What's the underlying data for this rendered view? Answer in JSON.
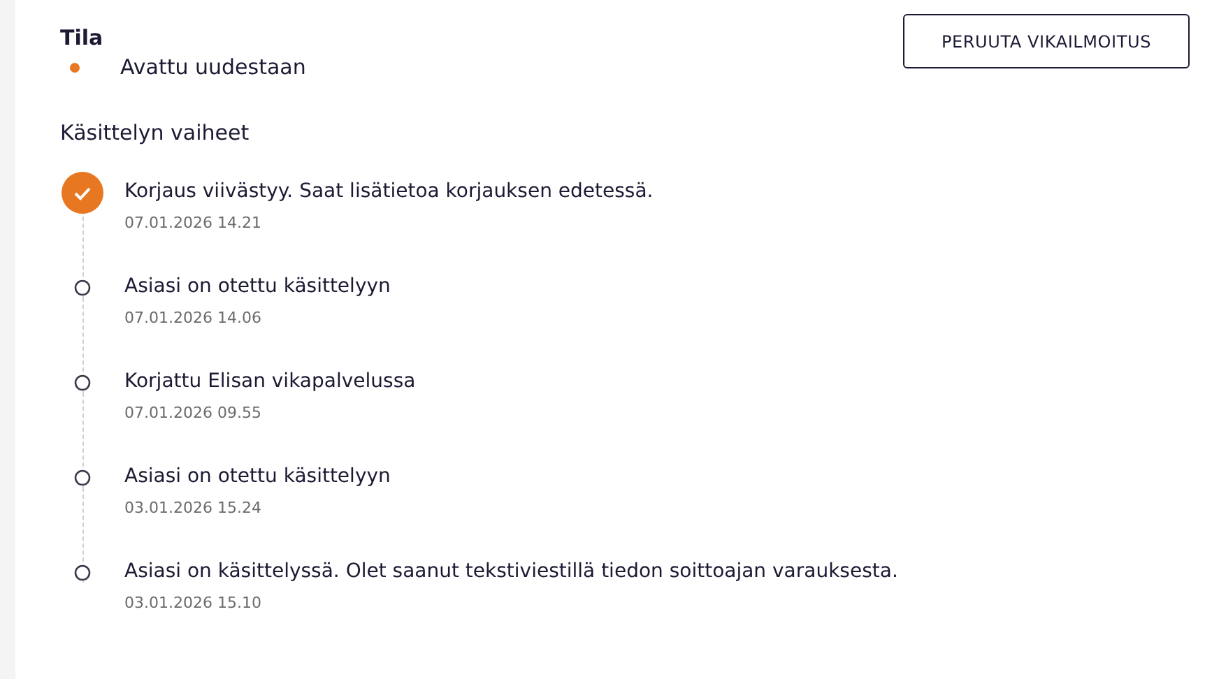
{
  "status": {
    "heading": "Tila",
    "value": "Avattu uudestaan",
    "color": "#e87722"
  },
  "cancel_button": "PERUUTA VIKAILMOITUS",
  "steps_heading": "Käsittelyn vaiheet",
  "steps": [
    {
      "text": "Korjaus viivästyy. Saat lisätietoa korjauksen edetessä.",
      "time": "07.01.2026 14.21",
      "completed": true
    },
    {
      "text": "Asiasi on otettu käsittelyyn",
      "time": "07.01.2026 14.06",
      "completed": false
    },
    {
      "text": "Korjattu Elisan vikapalvelussa",
      "time": "07.01.2026 09.55",
      "completed": false
    },
    {
      "text": "Asiasi on otettu käsittelyyn",
      "time": "03.01.2026 15.24",
      "completed": false
    },
    {
      "text": "Asiasi on käsittelyssä. Olet saanut tekstiviestillä tiedon soittoajan varauksesta.",
      "time": "03.01.2026 15.10",
      "completed": false
    }
  ]
}
